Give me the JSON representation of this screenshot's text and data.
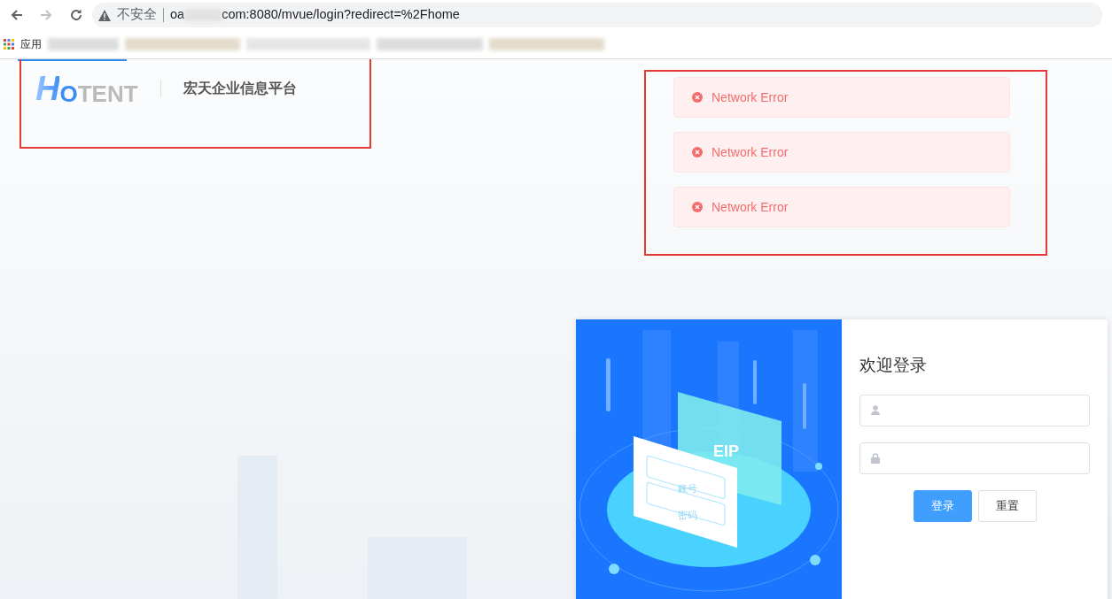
{
  "browser": {
    "security_label": "不安全",
    "url_start": "oa",
    "url_end": "com:8080/mvue/login?redirect=%2Fhome",
    "apps_label": "应用"
  },
  "header": {
    "logo_initial": "H",
    "logo_rest": "OTENT",
    "platform_name": "宏天企业信息平台"
  },
  "messages": [
    {
      "kind": "error",
      "text": "Network Error"
    },
    {
      "kind": "error",
      "text": "Network Error"
    },
    {
      "kind": "error",
      "text": "Network Error"
    }
  ],
  "illustration": {
    "badge": "EIP",
    "field_1": "账号",
    "field_2": "密码"
  },
  "login": {
    "title": "欢迎登录",
    "fields": [
      {
        "kind": "user"
      },
      {
        "kind": "password"
      }
    ],
    "buttons": [
      {
        "label": "登录",
        "primary": true
      },
      {
        "label": "重置",
        "primary": false
      }
    ]
  }
}
